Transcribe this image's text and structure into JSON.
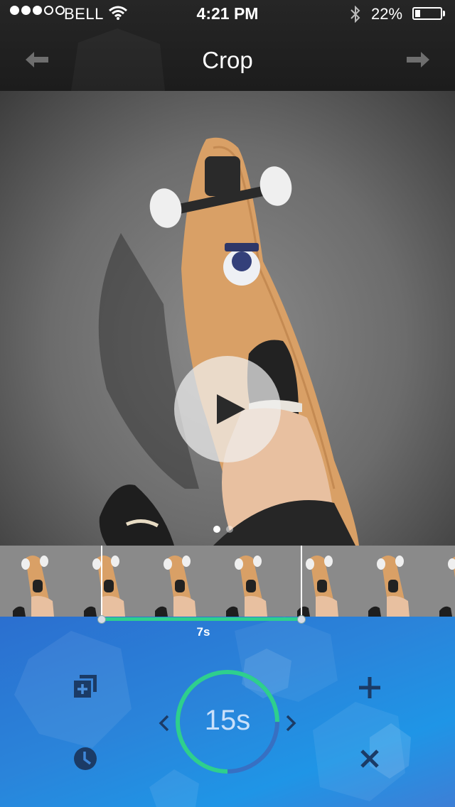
{
  "status_bar": {
    "carrier": "BELL",
    "signal_strength": 3,
    "signal_max": 5,
    "time": "4:21 PM",
    "battery": "22%",
    "battery_level": 0.22,
    "icons": [
      "wifi-icon",
      "bluetooth-icon",
      "battery-icon"
    ]
  },
  "nav": {
    "title": "Crop",
    "back_icon": "arrow-left-icon",
    "forward_icon": "arrow-right-icon"
  },
  "media": {
    "play_icon": "play-icon",
    "page_count": 2,
    "active_page": 0
  },
  "trim": {
    "duration": "7s",
    "frame_count": 7,
    "accent": "#2ecf8e"
  },
  "controls": {
    "timer": "15s",
    "timer_progress": 0.75,
    "timer_accent": "#2ecf8e",
    "icons": [
      "duplicate-icon",
      "clock-icon",
      "chevron-left-icon",
      "chevron-right-icon",
      "plus-icon",
      "close-icon"
    ]
  },
  "colors": {
    "panel_top": "#2b6fcf",
    "panel_bottom": "#1f95e6",
    "icon_dark": "#1b3b66"
  }
}
